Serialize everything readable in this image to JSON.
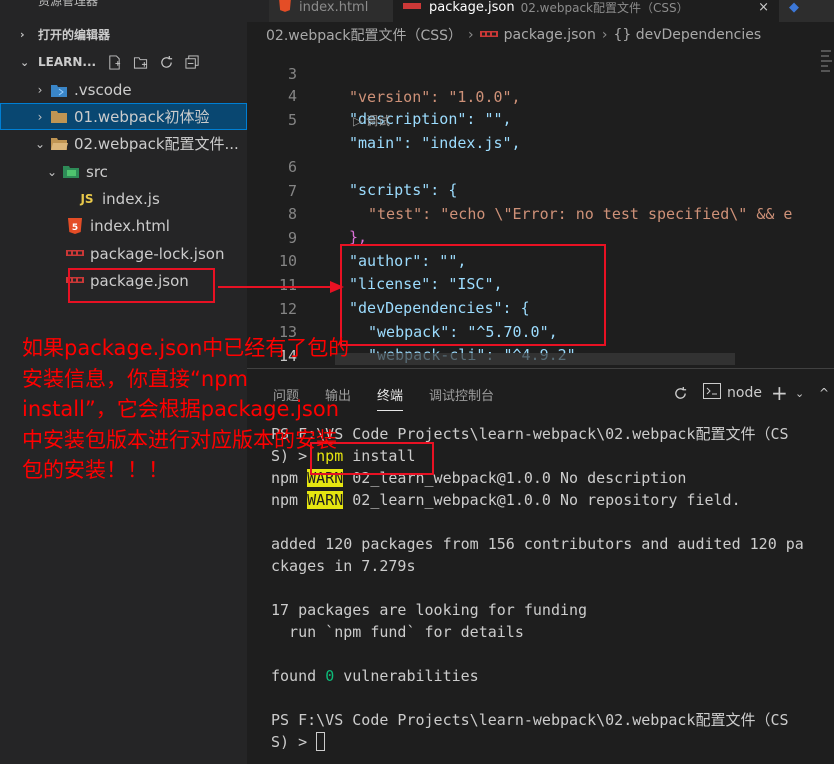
{
  "sidebar": {
    "top_title": "资源管理器",
    "open_editors_label": "打开的编辑器",
    "project_label": "LEARN...",
    "tree": [
      {
        "label": ".vscode",
        "kind": "folder"
      },
      {
        "label": "01.webpack初体验",
        "kind": "folder",
        "selected": true
      },
      {
        "label": "02.webpack配置文件...",
        "kind": "folder",
        "expanded": true
      },
      {
        "label": "src",
        "kind": "folder",
        "expanded": true
      },
      {
        "label": "index.js",
        "kind": "file"
      },
      {
        "label": "index.html",
        "kind": "file"
      },
      {
        "label": "package-lock.json",
        "kind": "file"
      },
      {
        "label": "package.json",
        "kind": "file"
      }
    ]
  },
  "tabs": [
    {
      "label": "index.html",
      "active": false
    },
    {
      "label": "package.json",
      "description": "02.webpack配置文件（CSS）",
      "active": true
    }
  ],
  "breadcrumb": [
    "02.webpack配置文件（CSS）",
    "package.json",
    "{} devDependencies"
  ],
  "editor": {
    "codelens": "▷ 调试",
    "lines": [
      {
        "n": "3",
        "code": "\"version\": \"1.0.0\","
      },
      {
        "n": "4",
        "code": "\"description\": \"\","
      },
      {
        "n": "5",
        "code": "\"main\": \"index.js\","
      },
      {
        "n": "6",
        "code": "\"scripts\": {"
      },
      {
        "n": "7",
        "code": "\"test\": \"echo \\\"Error: no test specified\\\" && e"
      },
      {
        "n": "8",
        "code": "},"
      },
      {
        "n": "9",
        "code": "\"author\": \"\","
      },
      {
        "n": "10",
        "code": "\"license\": \"ISC\","
      },
      {
        "n": "11",
        "code": "\"devDependencies\": {"
      },
      {
        "n": "12",
        "code": "\"webpack\": \"^5.70.0\","
      },
      {
        "n": "13",
        "code": "\"webpack-cli\": \"^4.9.2\""
      },
      {
        "n": "14",
        "code": "}"
      },
      {
        "n": "",
        "code": "}"
      }
    ]
  },
  "panel": {
    "tabs": [
      "问题",
      "输出",
      "终端",
      "调试控制台"
    ],
    "active_tab": "终端",
    "terminal_name": "node",
    "terminal": {
      "prompt1_a": "PS F:\\VS Code Projects\\learn-webpack\\02.webpack配置文件（CS",
      "prompt1_b": "S) > ",
      "cmd_npm": "npm",
      "cmd_rest": " install",
      "warn1_pre": "npm ",
      "warn_tag": "WARN",
      "warn1_post": " 02_learn_webpack@1.0.0 No description",
      "warn2_post": " 02_learn_webpack@1.0.0 No repository field.",
      "added_a": "added 120 packages from 156 contributors and audited 120 pa",
      "added_b": "ckages in 7.279s",
      "fund_a": "17 packages are looking for funding",
      "fund_b": "  run `npm fund` for details",
      "found_pre": "found ",
      "found_num": "0",
      "found_post": " vulnerabilities",
      "prompt2_a": "PS F:\\VS Code Projects\\learn-webpack\\02.webpack配置文件（CS",
      "prompt2_b": "S) > "
    }
  },
  "annotation": {
    "lines": [
      "如果package.json中已经有了包的",
      "安装信息，你直接“npm",
      "install”，它会根据package.json",
      "中安装包版本进行对应版本的安装",
      "包的安装！！！"
    ],
    "color": "#ff0000"
  },
  "colors": {
    "selection": "#094771",
    "warn_bg": "#e5e510",
    "string": "#ce9178",
    "key": "#9cdcfe"
  }
}
